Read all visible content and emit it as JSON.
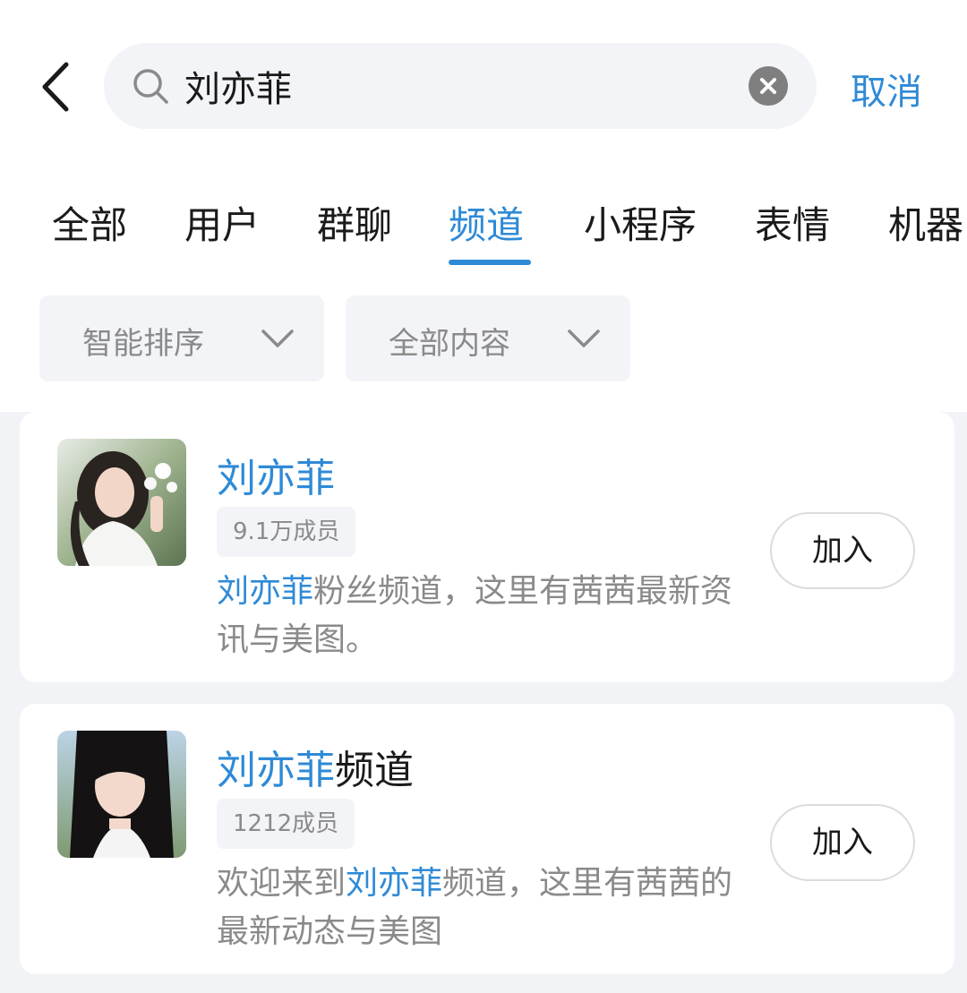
{
  "search": {
    "value": "刘亦菲",
    "cancel_label": "取消"
  },
  "tabs": [
    {
      "label": "全部"
    },
    {
      "label": "用户"
    },
    {
      "label": "群聊"
    },
    {
      "label": "频道",
      "active": true
    },
    {
      "label": "小程序"
    },
    {
      "label": "表情"
    },
    {
      "label": "机器"
    }
  ],
  "filters": {
    "sort_label": "智能排序",
    "content_label": "全部内容"
  },
  "results": [
    {
      "title_highlight": "刘亦菲",
      "title_rest": "",
      "members": "9.1万成员",
      "desc_pre": "",
      "desc_highlight": "刘亦菲",
      "desc_post": "粉丝频道，这里有茜茜最新资讯与美图。",
      "join_label": "加入"
    },
    {
      "title_highlight": "刘亦菲",
      "title_rest": "频道",
      "members": "1212成员",
      "desc_pre": "欢迎来到",
      "desc_highlight": "刘亦菲",
      "desc_post": "频道，这里有茜茜的最新动态与美图",
      "join_label": "加入"
    }
  ],
  "colors": {
    "accent": "#2f8ad6",
    "muted_text": "#8a8a8a",
    "panel": "#f3f4f7",
    "list_bg": "#f2f3f6"
  },
  "icons": {
    "back": "chevron-left-icon",
    "search": "search-icon",
    "clear": "clear-icon",
    "dropdown": "chevron-down-icon",
    "avatar": "avatar-photo"
  }
}
